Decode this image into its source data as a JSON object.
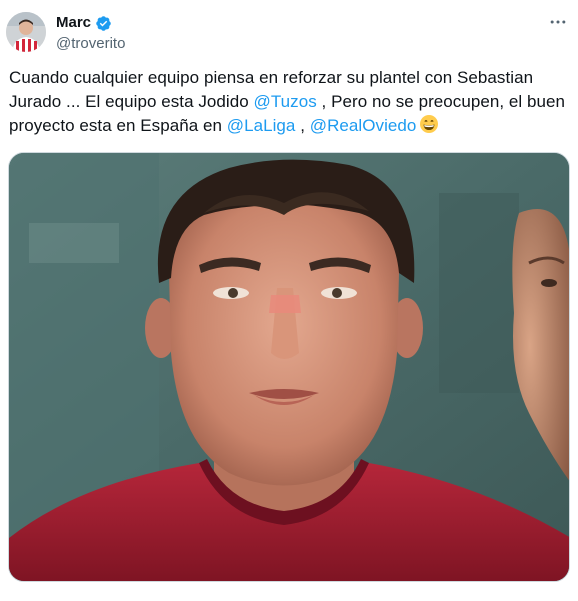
{
  "user": {
    "display_name": "Marc",
    "handle": "@troverito",
    "avatar_icon": "avatar-photo",
    "verified_icon": "verified-badge-icon"
  },
  "menu": {
    "more_icon": "more-horizontal-icon"
  },
  "tweet": {
    "text_1": "Cuando cualquier equipo piensa en reforzar su plantel con Sebastian Jurado ... El equipo esta Jodido ",
    "mention_1": "@Tuzos",
    "text_2": " , Pero no se preocupen, el buen proyecto esta en España en ",
    "mention_2": "@LaLiga",
    "text_3": " , ",
    "mention_3": "@RealOviedo",
    "emoji": "😁",
    "emoji_icon": "grinning-face-icon"
  },
  "media": {
    "type": "photo",
    "description_icon": "player-photo"
  },
  "colors": {
    "link": "#1d9bf0",
    "text": "#0f1419",
    "secondary": "#536471",
    "verified": "#1d9bf0"
  }
}
